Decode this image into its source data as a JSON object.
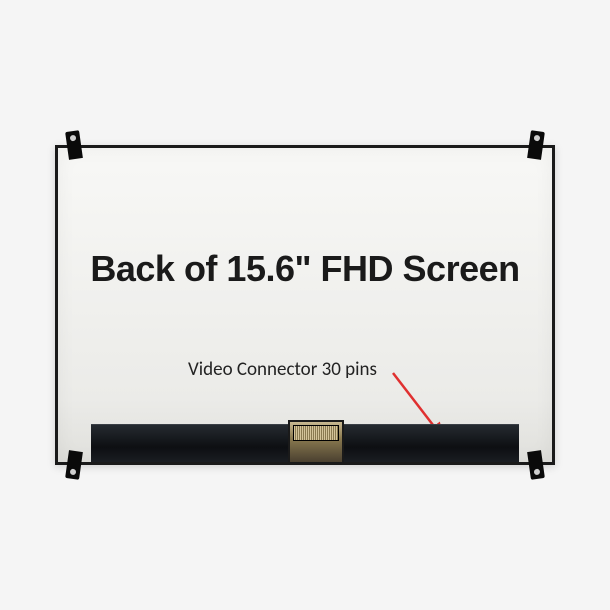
{
  "headline": "Back of 15.6\" FHD Screen",
  "connector_label": "Video Connector 30 pins"
}
